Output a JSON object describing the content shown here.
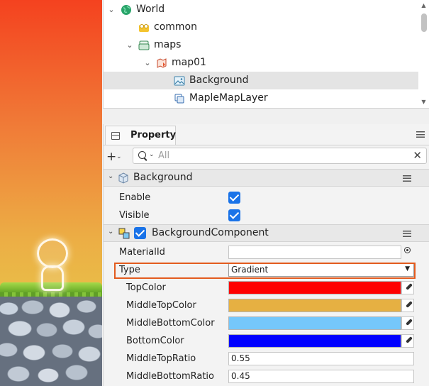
{
  "tree": {
    "items": [
      {
        "label": "World",
        "icon": "globe-icon",
        "expanded": true
      },
      {
        "label": "common",
        "icon": "common-folder-icon"
      },
      {
        "label": "maps",
        "icon": "maps-icon",
        "expanded": true
      },
      {
        "label": "map01",
        "icon": "map-icon",
        "expanded": true
      },
      {
        "label": "Background",
        "icon": "image-icon",
        "selected": true
      },
      {
        "label": "MapleMapLayer",
        "icon": "layer-icon"
      }
    ]
  },
  "property": {
    "tab_label": "Property",
    "search_placeholder": "All",
    "add_symbol": "+",
    "entity_section": {
      "label": "Background",
      "rows": [
        {
          "label": "Enable",
          "checked": true
        },
        {
          "label": "Visible",
          "checked": true
        }
      ]
    },
    "component_section": {
      "label": "BackgroundComponent",
      "enabled": true,
      "material_label": "MaterialId",
      "material_value": "",
      "type_label": "Type",
      "type_value": "Gradient",
      "colors": [
        {
          "label": "TopColor",
          "color": "#ff0000"
        },
        {
          "label": "MiddleTopColor",
          "color": "#e6b042"
        },
        {
          "label": "MiddleBottomColor",
          "color": "#75c7fa"
        },
        {
          "label": "BottomColor",
          "color": "#0000ff"
        }
      ],
      "ratios": [
        {
          "label": "MiddleTopRatio",
          "value": "0.55"
        },
        {
          "label": "MiddleBottomRatio",
          "value": "0.45"
        }
      ]
    }
  }
}
